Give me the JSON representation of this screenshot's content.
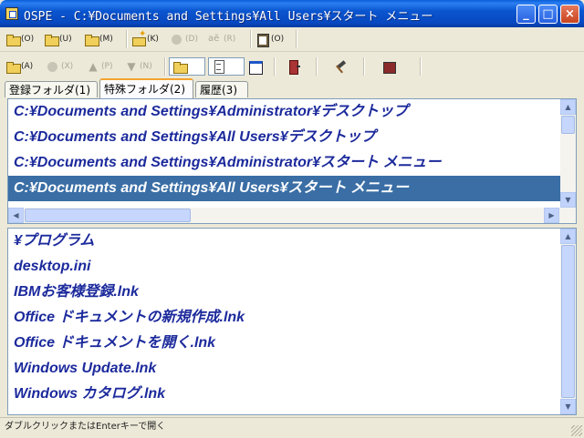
{
  "window": {
    "title": "OSPE - C:¥Documents and Settings¥All Users¥スタート メニュー",
    "minimize_label": "_",
    "maximize_label": "□",
    "close_label": "×"
  },
  "toolbar1": {
    "items": [
      {
        "icon": "open-folder-icon",
        "key": "(O)"
      },
      {
        "icon": "up-folder-icon",
        "key": "(U)"
      },
      {
        "icon": "move-folder-icon",
        "key": "(M)"
      },
      {
        "icon": "new-folder-icon",
        "key": "(K)"
      },
      {
        "icon": "delete-icon",
        "key": "(D)"
      },
      {
        "icon": "rename-icon",
        "key": "(R)"
      },
      {
        "icon": "paste-icon",
        "key": "(O)"
      }
    ]
  },
  "toolbar2": {
    "items": [
      {
        "icon": "open-icon",
        "key": "(A)"
      },
      {
        "icon": "remove-icon",
        "key": "(X)"
      },
      {
        "icon": "up-arrow-icon",
        "key": "(P)"
      },
      {
        "icon": "down-arrow-icon",
        "key": "(N)"
      }
    ]
  },
  "tabs": [
    "登録フォルダ(1)",
    "特殊フォルダ(2)",
    "履歴(3)"
  ],
  "active_tab": 1,
  "folder_list": [
    "C:¥Documents and Settings¥Administrator¥デスクトップ",
    "C:¥Documents and Settings¥All Users¥デスクトップ",
    "C:¥Documents and Settings¥Administrator¥スタート メニュー",
    "C:¥Documents and Settings¥All Users¥スタート メニュー"
  ],
  "selected_folder": 3,
  "file_list": [
    "¥プログラム",
    "desktop.ini",
    "IBMお客様登録.lnk",
    "Office ドキュメントの新規作成.lnk",
    "Office ドキュメントを開く.lnk",
    "Windows Update.lnk",
    "Windows カタログ.lnk"
  ],
  "status": "ダブルクリックまたはEnterキーで開く",
  "colors": {
    "selection": "#3a6ea5",
    "list_text": "#1c2a9c",
    "titlebar": "#0a56d0"
  }
}
